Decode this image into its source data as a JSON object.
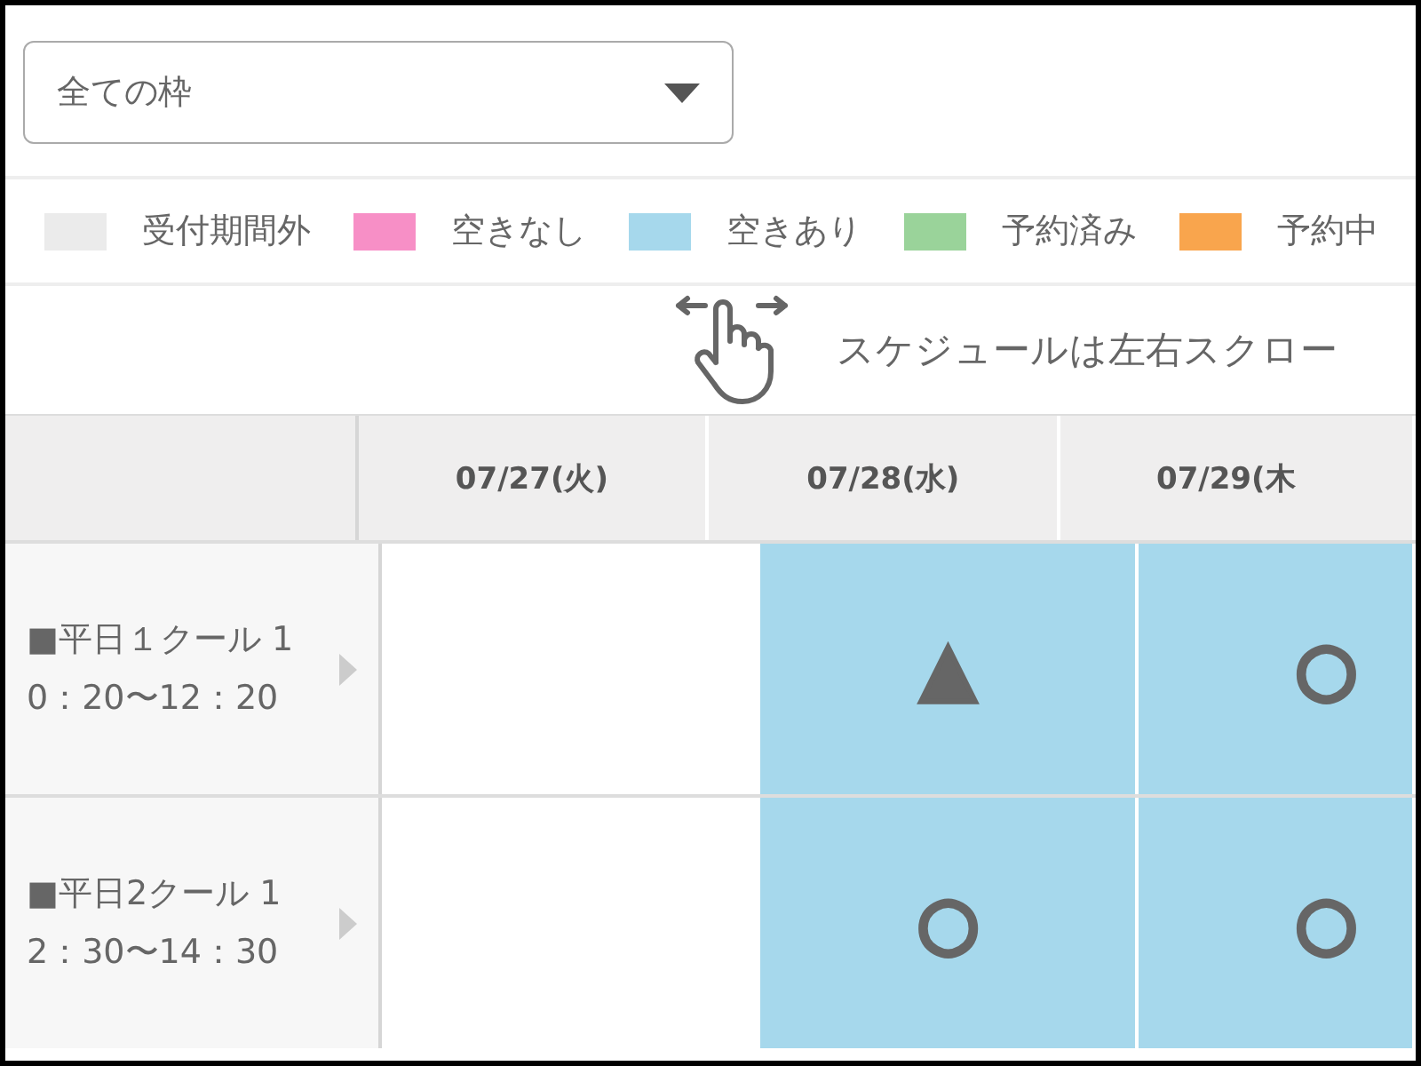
{
  "filter_select": {
    "value": "全ての枠"
  },
  "legend": [
    {
      "label": "受付期間外",
      "color": "#ebebeb"
    },
    {
      "label": "空きなし",
      "color": "#f78fc6"
    },
    {
      "label": "空きあり",
      "color": "#a6d8ec"
    },
    {
      "label": "予約済み",
      "color": "#9ad39a"
    },
    {
      "label": "予約中",
      "color": "#f9a54d"
    }
  ],
  "scroll_hint": "スケジュールは左右スクロー",
  "table": {
    "columns": [
      "07/27(火)",
      "07/28(水)",
      "07/29(木"
    ],
    "rows": [
      {
        "label": "■平日１クール 10：20〜12：20",
        "cells": [
          {},
          {
            "color": "#a6d8ec",
            "symbol": "▲"
          },
          {
            "color": "#a6d8ec",
            "symbol": "○"
          }
        ]
      },
      {
        "label": "■平日2クール 12：30〜14：30",
        "cells": [
          {},
          {
            "color": "#a6d8ec",
            "symbol": "○"
          },
          {
            "color": "#a6d8ec",
            "symbol": "○"
          }
        ]
      }
    ]
  }
}
